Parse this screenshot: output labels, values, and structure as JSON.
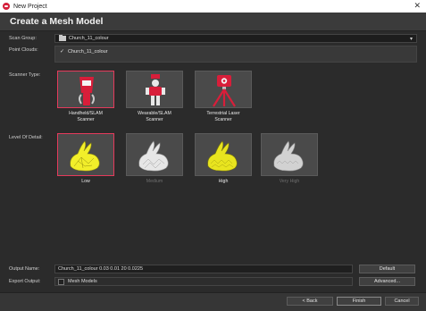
{
  "window": {
    "title": "New Project",
    "close_glyph": "✕"
  },
  "header": {
    "title": "Create a Mesh Model"
  },
  "form": {
    "scan_group_label": "Scan Group:",
    "scan_group_value": "Church_11_colour",
    "point_clouds_label": "Point Clouds:",
    "point_clouds": [
      {
        "name": "Church_11_colour",
        "checked": true
      }
    ],
    "scanner_type_label": "Scanner Type:",
    "scanner_types": [
      {
        "label": "Handheld/SLAM Scanner",
        "line1": "Handheld/SLAM",
        "line2": "Scanner",
        "selected": true
      },
      {
        "label": "Wearable/SLAM Scanner",
        "line1": "Wearable/SLAM",
        "line2": "Scanner",
        "selected": false
      },
      {
        "label": "Terrestrial Laser Scanner",
        "line1": "Terrestrial Laser",
        "line2": "Scanner",
        "selected": false
      }
    ],
    "level_of_detail_label": "Level Of Detail:",
    "levels_of_detail": [
      {
        "label": "Low",
        "selected": true,
        "enabled": true
      },
      {
        "label": "Medium",
        "selected": false,
        "enabled": false
      },
      {
        "label": "High",
        "selected": false,
        "enabled": true
      },
      {
        "label": "Very High",
        "selected": false,
        "enabled": false
      }
    ],
    "output_name_label": "Output Name:",
    "output_name_value": "Church_11_colour 0.03 0.01 20 0.0225",
    "default_button": "Default",
    "export_output_label": "Export Output:",
    "mesh_models_label": "Mesh Models",
    "mesh_models_checked": false,
    "advanced_button": "Advanced..."
  },
  "footer": {
    "back_label": "< Back",
    "finish_label": "Finish",
    "cancel_label": "Cancel"
  },
  "colors": {
    "accent": "#e53a5b",
    "selected_fill": "#f2ee2a",
    "scanner_red": "#d81e3a"
  }
}
